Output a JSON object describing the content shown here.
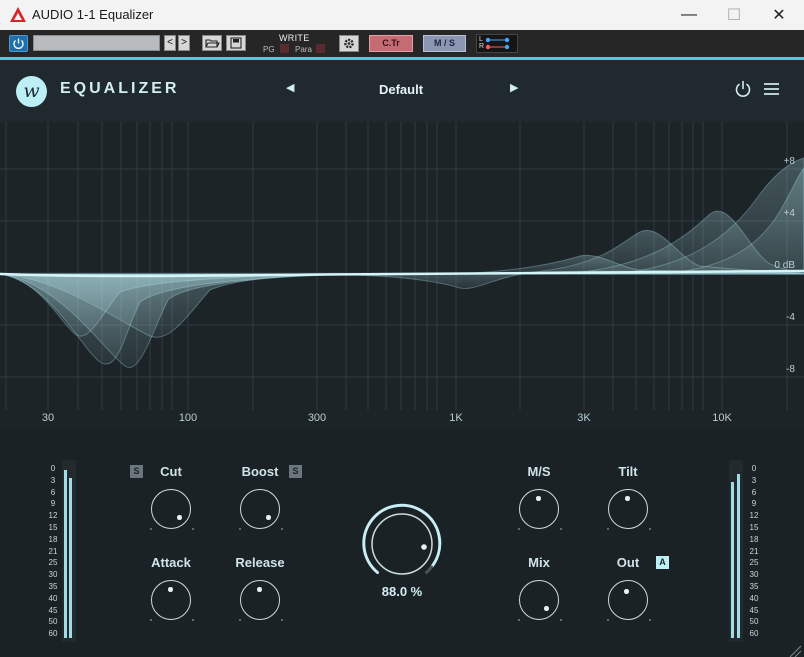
{
  "window": {
    "title": "AUDIO 1-1 Equalizer",
    "minimize_glyph": "—",
    "maximize_glyph": "☐",
    "close_glyph": "✕"
  },
  "host_toolbar": {
    "nav_prev": "<",
    "nav_next": ">",
    "write_label": "WRITE",
    "pg_label": "PG",
    "para_label": "Para",
    "ctr_label": "C.Tr",
    "ms_label": "M / S",
    "lr_l": "L",
    "lr_r": "R"
  },
  "plugin": {
    "logo_letter": "w",
    "brand": "EQUALIZER",
    "preset_prev": "◀",
    "preset_next": "▶",
    "preset_name": "Default"
  },
  "graph": {
    "db_labels": [
      "+8",
      "+4",
      "0 dB",
      "-4",
      "-8"
    ],
    "freq_labels": [
      "30",
      "100",
      "300",
      "1K",
      "3K",
      "10K"
    ]
  },
  "controls": {
    "cut_label": "Cut",
    "boost_label": "Boost",
    "attack_label": "Attack",
    "release_label": "Release",
    "ms_label": "M/S",
    "tilt_label": "Tilt",
    "mix_label": "Mix",
    "out_label": "Out",
    "solo_badge": "S",
    "auto_badge": "A",
    "main_value": "88.0 %",
    "meter_scale": [
      "0",
      "3",
      "6",
      "9",
      "12",
      "15",
      "18",
      "21",
      "25",
      "30",
      "35",
      "40",
      "45",
      "50",
      "60"
    ]
  },
  "colors": {
    "accent": "#53c8d8",
    "curve": "#bdeff6",
    "panel": "#1d2529"
  }
}
